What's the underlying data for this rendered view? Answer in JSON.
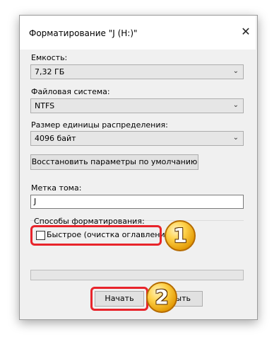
{
  "dialog": {
    "title": "Форматирование \"J (H:)\"",
    "close_symbol": "✕",
    "capacity": {
      "label": "Емкость:",
      "value": "7,32 ГБ"
    },
    "filesystem": {
      "label": "Файловая система:",
      "value": "NTFS"
    },
    "allocation": {
      "label": "Размер единицы распределения:",
      "value": "4096 байт"
    },
    "restore_defaults_label": "Восстановить параметры по умолчанию",
    "volume_label": {
      "label": "Метка тома:",
      "value": "J"
    },
    "format_options": {
      "group_label": "Способы форматирования:",
      "quick_format_label": "Быстрое (очистка оглавления)",
      "quick_format_checked": false
    },
    "progress": 0,
    "start_label": "Начать",
    "close_label_visible": "рыть"
  },
  "annotations": {
    "badge_1": "1",
    "badge_2": "2",
    "highlight_color": "#e8242b"
  }
}
